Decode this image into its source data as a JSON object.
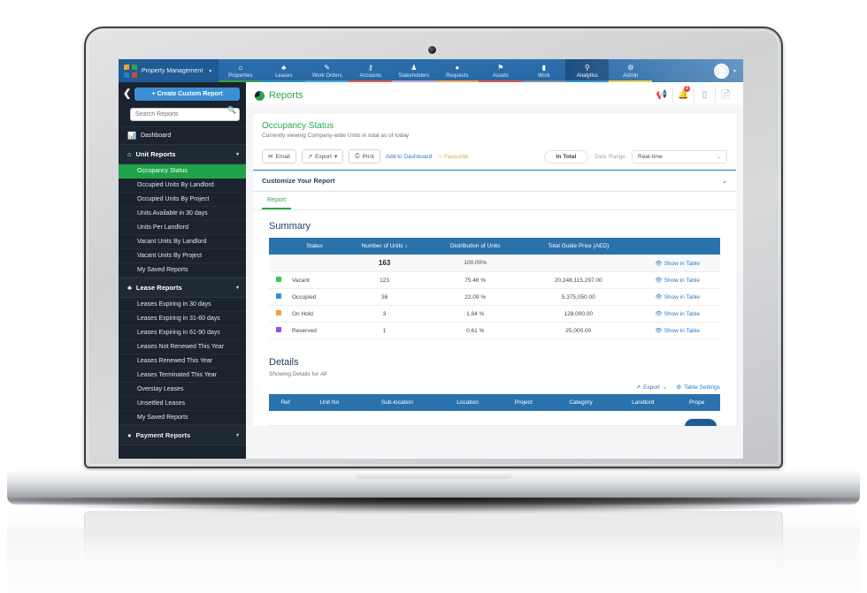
{
  "topnav": {
    "brand": {
      "label": "Property Management",
      "caret": "▾",
      "logo_icon": "pinwheel-logo"
    },
    "items": [
      {
        "label": "Properties",
        "icon": "home-icon",
        "glyph": "⌂",
        "underline": "#3aa14a"
      },
      {
        "label": "Leases",
        "icon": "handshake-icon",
        "glyph": "♣",
        "underline": "#2f8fd0"
      },
      {
        "label": "Work Orders",
        "icon": "clipboard-icon",
        "glyph": "✎",
        "underline": "#4aa3dd"
      },
      {
        "label": "Accounts",
        "icon": "key-icon",
        "glyph": "⚷",
        "underline": "#e05a45"
      },
      {
        "label": "Stakeholders",
        "icon": "person-icon",
        "glyph": "♟",
        "underline": "#b9a6d6"
      },
      {
        "label": "Requests",
        "icon": "comment-icon",
        "glyph": "●",
        "underline": "#f0a55a"
      },
      {
        "label": "Assets",
        "icon": "tag-icon",
        "glyph": "⚑",
        "underline": "#e2564a"
      },
      {
        "label": "Work",
        "icon": "briefcase-icon",
        "glyph": "▮",
        "underline": "#7f8e9c"
      },
      {
        "label": "Analytics",
        "icon": "gauge-icon",
        "glyph": "⚲",
        "underline": "#2f8fd0"
      },
      {
        "label": "Admin",
        "icon": "gear-icon",
        "glyph": "⚙",
        "underline": "#f0c84a"
      }
    ],
    "active_item": "Analytics",
    "avatar_caret": "▾"
  },
  "sidebar": {
    "collapse_icon": "chevron-left-icon",
    "create_button": "+ Create Custom Report",
    "search_placeholder": "Search Reports",
    "search_value": "",
    "search_icon": "search-icon",
    "dashboard": {
      "label": "Dashboard",
      "icon": "bar-chart-icon"
    },
    "groups": [
      {
        "label": "Unit Reports",
        "icon": "home-icon",
        "caret": "▾",
        "items": [
          "Occupancy Status",
          "Occupied Units By Landlord",
          "Occupied Units By Project",
          "Units Available in 30 days",
          "Units Per Landlord",
          "Vacant Units By Landlord",
          "Vacant Units By Project",
          "My Saved Reports"
        ]
      },
      {
        "label": "Lease Reports",
        "icon": "handshake-icon",
        "caret": "▾",
        "items": [
          "Leases Expiring in 30 days",
          "Leases Expiring in 31-60 days",
          "Leases Expiring in 61-90 days",
          "Leases Not Renewed This Year",
          "Leases Renewed This Year",
          "Leases Terminated This Year",
          "Overstay Leases",
          "Unsettled Leases",
          "My Saved Reports"
        ]
      }
    ],
    "active_item": "Occupancy Status",
    "partial_group_label": "Payment Reports"
  },
  "header": {
    "title": "Reports",
    "title_icon": "pie-chart-icon",
    "actions": [
      {
        "name": "megaphone-icon",
        "glyph": "📢",
        "badge": ""
      },
      {
        "name": "bell-icon",
        "glyph": "🔔",
        "badge": "2"
      },
      {
        "name": "mobile-icon",
        "glyph": "▯",
        "badge": ""
      },
      {
        "name": "document-icon",
        "glyph": "📄",
        "badge": ""
      }
    ]
  },
  "report": {
    "title": "Occupancy Status",
    "subtitle": "Currently viewing Company-wide Units in total as of today",
    "toolbar": {
      "email_label": "Email",
      "email_icon": "envelope-icon",
      "export_label": "Export",
      "export_icon": "export-icon",
      "export_caret": "▾",
      "print_label": "Print",
      "print_icon": "printer-icon",
      "add_to_dashboard_label": "Add to Dashboard",
      "favourite_label": "Favourite",
      "favourite_icon": "star-icon",
      "total_pill": "In Total",
      "date_range_label": "Date Range",
      "date_range_value": "Real-time",
      "date_range_caret": "⌄"
    },
    "customize_label": "Customize Your Report",
    "customize_caret": "⌄",
    "tabs": [
      {
        "label": "Report",
        "active": true
      }
    ]
  },
  "summary": {
    "title": "Summary",
    "columns": [
      "",
      "Status",
      "Number of Units",
      "Distribution of Units",
      "Total Guide Price (AED)",
      ""
    ],
    "sort_column": "Number of Units",
    "sort_icon": "sort-down-arrow",
    "show_in_table_label": "Show in Table",
    "show_in_table_icon": "eye-icon",
    "total_row": {
      "status": "",
      "number_of_units": "163",
      "distribution": "100.00%",
      "total_guide_price": ""
    },
    "rows": [
      {
        "color": "#2ecc55",
        "status": "Vacant",
        "number_of_units": "123",
        "distribution": "75.46 %",
        "total_guide_price": "20,248,115,297.00"
      },
      {
        "color": "#2f8fd0",
        "status": "Occupied",
        "number_of_units": "36",
        "distribution": "22.09 %",
        "total_guide_price": "5,375,050.00"
      },
      {
        "color": "#f0a030",
        "status": "On Hold",
        "number_of_units": "3",
        "distribution": "1.84 %",
        "total_guide_price": "128,000.00"
      },
      {
        "color": "#9b4ddb",
        "status": "Reserved",
        "number_of_units": "1",
        "distribution": "0.61 %",
        "total_guide_price": "25,000.00"
      }
    ]
  },
  "details": {
    "title": "Details",
    "subtitle_prefix": "Showing Details for ",
    "subtitle_value": "All",
    "export_label": "Export",
    "export_icon": "export-icon",
    "export_caret": "⌄",
    "table_settings_label": "Table Settings",
    "table_settings_icon": "gear-icon",
    "columns": [
      "Ref",
      "Unit No",
      "Sub-location",
      "Location",
      "Project",
      "Category",
      "Landlord",
      "Prope"
    ]
  },
  "chart_data": {
    "type": "table",
    "title": "Occupancy Status — Summary",
    "categories": [
      "Vacant",
      "Occupied",
      "On Hold",
      "Reserved"
    ],
    "series": [
      {
        "name": "Number of Units",
        "values": [
          123,
          36,
          3,
          1
        ]
      },
      {
        "name": "Distribution of Units (%)",
        "values": [
          75.46,
          22.09,
          1.84,
          0.61
        ]
      },
      {
        "name": "Total Guide Price (AED)",
        "values": [
          20248115297.0,
          5375050.0,
          128000.0,
          25000.0
        ]
      }
    ],
    "total": {
      "number_of_units": 163,
      "distribution_percent": 100.0
    },
    "colors": [
      "#2ecc55",
      "#2f8fd0",
      "#f0a030",
      "#9b4ddb"
    ],
    "legend_position": "inline-swatch"
  }
}
